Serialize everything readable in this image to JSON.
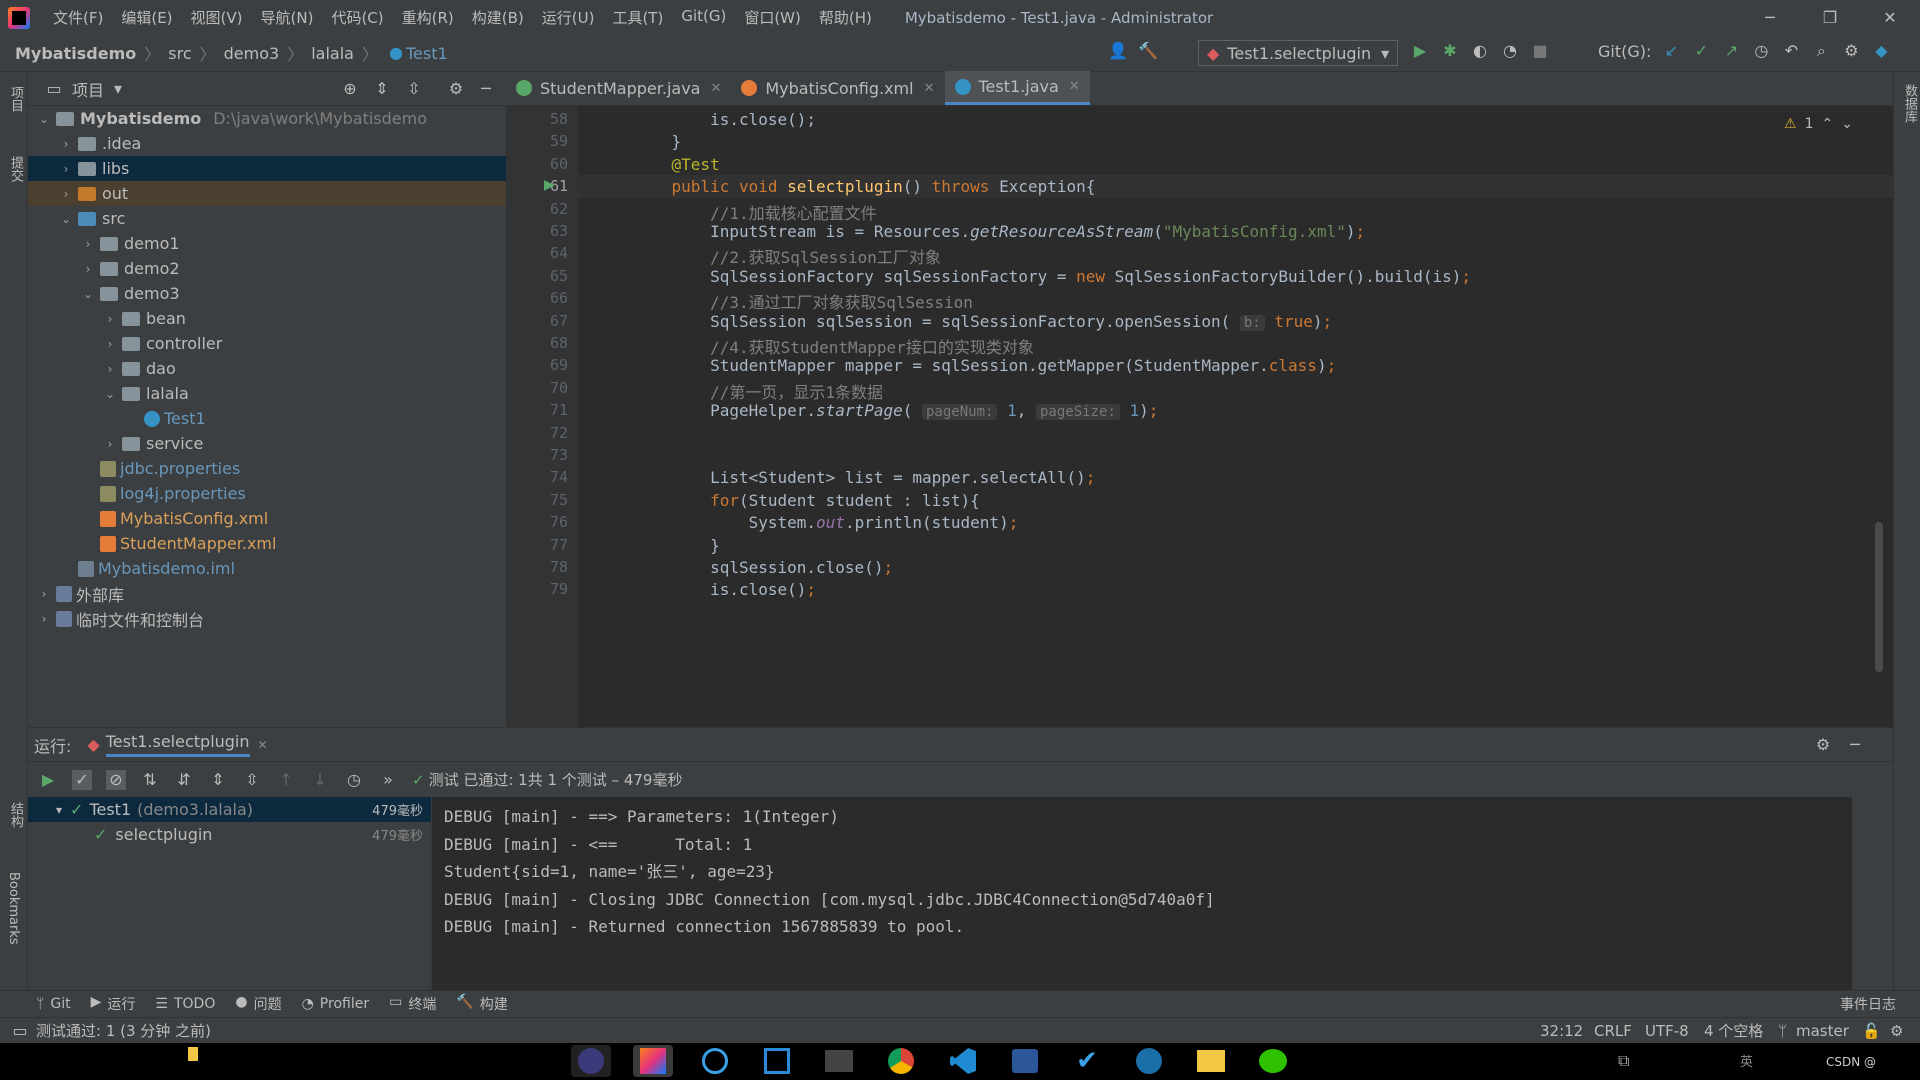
{
  "titlebar": {
    "menus": [
      "文件(F)",
      "编辑(E)",
      "视图(V)",
      "导航(N)",
      "代码(C)",
      "重构(R)",
      "构建(B)",
      "运行(U)",
      "工具(T)",
      "Git(G)",
      "窗口(W)",
      "帮助(H)"
    ],
    "title": "Mybatisdemo - Test1.java - Administrator"
  },
  "breadcrumb": [
    "Mybatisdemo",
    "src",
    "demo3",
    "lalala",
    "Test1"
  ],
  "toolbar": {
    "run_config": "Test1.selectplugin",
    "git_label": "Git(G):"
  },
  "project_panel": {
    "title": "项目",
    "tree": [
      {
        "label": "Mybatisdemo",
        "path": "D:\\java\\work\\Mybatisdemo",
        "depth": 0,
        "expanded": true,
        "type": "module"
      },
      {
        "label": ".idea",
        "depth": 1,
        "expanded": false,
        "type": "folder"
      },
      {
        "label": "libs",
        "depth": 1,
        "expanded": false,
        "type": "folder"
      },
      {
        "label": "out",
        "depth": 1,
        "expanded": false,
        "type": "out"
      },
      {
        "label": "src",
        "depth": 1,
        "expanded": true,
        "type": "src"
      },
      {
        "label": "demo1",
        "depth": 2,
        "expanded": false,
        "type": "pkg"
      },
      {
        "label": "demo2",
        "depth": 2,
        "expanded": false,
        "type": "pkg"
      },
      {
        "label": "demo3",
        "depth": 2,
        "expanded": true,
        "type": "pkg"
      },
      {
        "label": "bean",
        "depth": 3,
        "expanded": false,
        "type": "pkg"
      },
      {
        "label": "controller",
        "depth": 3,
        "expanded": false,
        "type": "pkg"
      },
      {
        "label": "dao",
        "depth": 3,
        "expanded": false,
        "type": "pkg"
      },
      {
        "label": "lalala",
        "depth": 3,
        "expanded": true,
        "type": "pkg"
      },
      {
        "label": "Test1",
        "depth": 4,
        "type": "class"
      },
      {
        "label": "service",
        "depth": 3,
        "expanded": false,
        "type": "pkg"
      },
      {
        "label": "jdbc.properties",
        "depth": 2,
        "type": "prop"
      },
      {
        "label": "log4j.properties",
        "depth": 2,
        "type": "prop"
      },
      {
        "label": "MybatisConfig.xml",
        "depth": 2,
        "type": "xml"
      },
      {
        "label": "StudentMapper.xml",
        "depth": 2,
        "type": "xml"
      },
      {
        "label": "Mybatisdemo.iml",
        "depth": 1,
        "type": "iml"
      },
      {
        "label": "外部库",
        "depth": 0,
        "expanded": false,
        "type": "lib"
      },
      {
        "label": "临时文件和控制台",
        "depth": 0,
        "expanded": false,
        "type": "scratch"
      }
    ]
  },
  "editor": {
    "tabs": [
      {
        "label": "StudentMapper.java",
        "icon": "interface-icon",
        "active": false
      },
      {
        "label": "MybatisConfig.xml",
        "icon": "xml-icon",
        "active": false
      },
      {
        "label": "Test1.java",
        "icon": "class-icon",
        "active": true
      }
    ],
    "warning_count": "1",
    "lines": [
      {
        "n": "58",
        "html": "        is.close();"
      },
      {
        "n": "59",
        "html": "    }"
      },
      {
        "n": "60",
        "html": "    <span class='ann'>@Test</span>"
      },
      {
        "n": "61",
        "html": "    <span class='kw'>public void </span><span class='fn'>selectplugin</span>() <span class='kw'>throws </span>Exception{"
      },
      {
        "n": "62",
        "html": "        <span class='cm'>//1.加载核心配置文件</span>"
      },
      {
        "n": "63",
        "html": "        InputStream is = Resources.<span class='it'>getResourceAsStream</span>(<span class='str'>\"MybatisConfig.xml\"</span>)<span class='kw'>;</span>"
      },
      {
        "n": "64",
        "html": "        <span class='cm'>//2.获取SqlSession工厂对象</span>"
      },
      {
        "n": "65",
        "html": "        SqlSessionFactory sqlSessionFactory = <span class='kw'>new </span>SqlSessionFactoryBuilder().build(is)<span class='kw'>;</span>"
      },
      {
        "n": "66",
        "html": "        <span class='cm'>//3.通过工厂对象获取SqlSession</span>"
      },
      {
        "n": "67",
        "html": "        SqlSession sqlSession = sqlSessionFactory.openSession( <span class='hint'>b:</span> <span class='kw'>true</span>)<span class='kw'>;</span>"
      },
      {
        "n": "68",
        "html": "        <span class='cm'>//4.获取StudentMapper接口的实现类对象</span>"
      },
      {
        "n": "69",
        "html": "        StudentMapper mapper = sqlSession.getMapper(StudentMapper.<span class='kw'>class</span>)<span class='kw'>;</span>"
      },
      {
        "n": "70",
        "html": "        <span class='cm'>//第一页，显示1条数据</span>"
      },
      {
        "n": "71",
        "html": "        PageHelper.<span class='it'>startPage</span>( <span class='hint'>pageNum:</span> <span class='num'>1</span>, <span class='hint'>pageSize:</span> <span class='num'>1</span>)<span class='kw'>;</span>"
      },
      {
        "n": "72",
        "html": ""
      },
      {
        "n": "73",
        "html": ""
      },
      {
        "n": "74",
        "html": "        List&lt;Student&gt; list = mapper.selectAll()<span class='kw'>;</span>"
      },
      {
        "n": "75",
        "html": "        <span class='kw'>for</span>(Student student : list){"
      },
      {
        "n": "76",
        "html": "            System.<span class='fld'>out</span>.println(student)<span class='kw'>;</span>"
      },
      {
        "n": "77",
        "html": "        }"
      },
      {
        "n": "78",
        "html": "        sqlSession.close()<span class='kw'>;</span>"
      },
      {
        "n": "79",
        "html": "        is.close()<span class='kw'>;</span>"
      }
    ]
  },
  "run_panel": {
    "label": "运行:",
    "tab": "Test1.selectplugin",
    "result": "测试 已通过: 1共 1 个测试 – 479毫秒",
    "tests": [
      {
        "label": "Test1",
        "suffix": "(demo3.lalala)",
        "time": "479毫秒"
      },
      {
        "label": "selectplugin",
        "time": "479毫秒"
      }
    ],
    "console": [
      "DEBUG [main] - ==> Parameters: 1(Integer)",
      "DEBUG [main] - <==      Total: 1",
      "Student{sid=1, name='张三', age=23}",
      "DEBUG [main] - Closing JDBC Connection [com.mysql.jdbc.JDBC4Connection@5d740a0f]",
      "DEBUG [main] - Returned connection 1567885839 to pool."
    ]
  },
  "bottom_tabs": [
    "Git",
    "运行",
    "TODO",
    "问题",
    "Profiler",
    "终端",
    "构建"
  ],
  "event_log": "事件日志",
  "status": {
    "message": "测试通过: 1 (3 分钟 之前)",
    "position": "32:12",
    "line_sep": "CRLF",
    "encoding": "UTF-8",
    "indent": "4 个空格",
    "branch": "master"
  },
  "left_strip": [
    "项目",
    "提交",
    "结构",
    "Bookmarks"
  ],
  "right_strip": [
    "数据库"
  ],
  "taskbar": {
    "csdn": "CSDN @"
  }
}
